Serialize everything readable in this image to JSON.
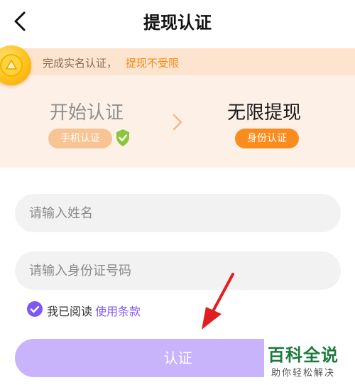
{
  "header": {
    "title": "提现认证",
    "back_icon": "chevron-left-icon"
  },
  "banner": {
    "notice_text": "完成实名认证，",
    "notice_link": "提现不受限",
    "coin_icon": "gold-coin-icon",
    "steps": [
      {
        "title": "开始认证",
        "badge": "手机认证",
        "status_icon": "shield-check-icon"
      },
      {
        "title": "无限提现",
        "badge": "身份认证"
      }
    ],
    "colors": {
      "notice_bg": "#fde4cf",
      "banner_bg": "#fdf0e6",
      "accent_orange": "#fa8c1e",
      "muted_orange": "#f7c494",
      "shield_green": "#8cc63f"
    }
  },
  "form": {
    "name_placeholder": "请输入姓名",
    "id_placeholder": "请输入身份证号码",
    "agree_text": "我已阅读",
    "terms_link": "使用条款",
    "agreed": true,
    "submit_label": "认证",
    "colors": {
      "accent_purple": "#7f57f5",
      "submit_disabled": "#c8b4fb",
      "field_bg": "#f2f2f2"
    }
  },
  "overlay": {
    "arrow_color": "#e02020"
  },
  "watermark": {
    "title": "百科全说",
    "subtitle": "助你轻松解决"
  }
}
